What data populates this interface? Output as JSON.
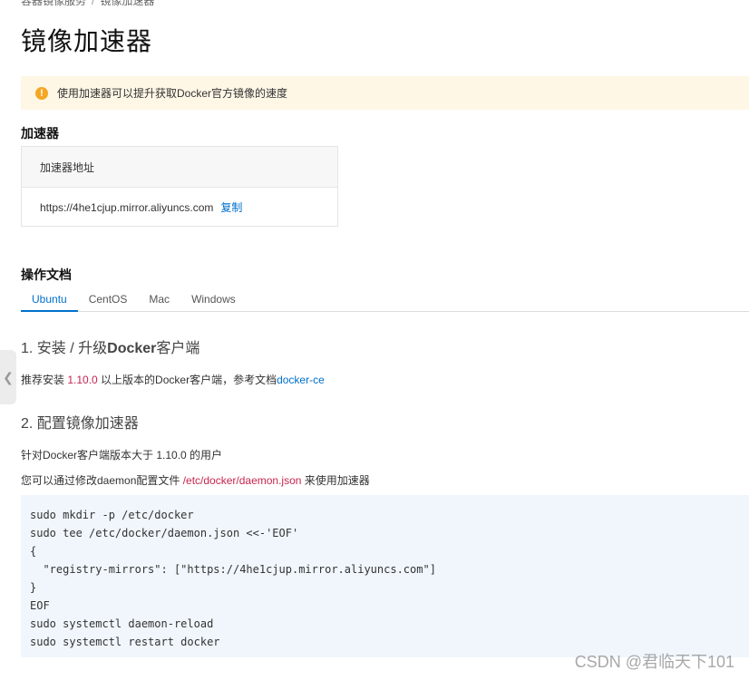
{
  "breadcrumb": {
    "parent": "容器镜像服务",
    "current": "镜像加速器"
  },
  "page_title": "镜像加速器",
  "notice": {
    "icon": "warning-icon",
    "text": "使用加速器可以提升获取Docker官方镜像的速度"
  },
  "accelerator": {
    "section_title": "加速器",
    "header": "加速器地址",
    "url": "https://4he1cjup.mirror.aliyuncs.com",
    "copy_label": "复制"
  },
  "docs": {
    "section_title": "操作文档",
    "tabs": [
      "Ubuntu",
      "CentOS",
      "Mac",
      "Windows"
    ],
    "active_tab": "Ubuntu"
  },
  "step1": {
    "title_prefix": "1. 安装 / 升级",
    "title_bold": "Docker",
    "title_suffix": "客户端",
    "text_before": "推荐安装 ",
    "version": "1.10.0",
    "text_after": " 以上版本的Docker客户端，参考文档",
    "link": "docker-ce"
  },
  "step2": {
    "title": "2. 配置镜像加速器",
    "line1": "针对Docker客户端版本大于 1.10.0 的用户",
    "line2_before": "您可以通过修改daemon配置文件 ",
    "line2_path": "/etc/docker/daemon.json",
    "line2_after": " 来使用加速器",
    "code": [
      "sudo mkdir -p /etc/docker",
      "sudo tee /etc/docker/daemon.json <<-'EOF'",
      "{",
      "  \"registry-mirrors\": [\"https://4he1cjup.mirror.aliyuncs.com\"]",
      "}",
      "EOF",
      "sudo systemctl daemon-reload",
      "sudo systemctl restart docker"
    ]
  },
  "side_tab_icon": "chevron-left-icon",
  "watermark": "CSDN @君临天下101",
  "colors": {
    "accent": "#0070cc",
    "warning": "#f5a623",
    "notice_bg": "#fff7e6",
    "code_bg": "#f0f6fc",
    "highlight": "#c7254e"
  }
}
